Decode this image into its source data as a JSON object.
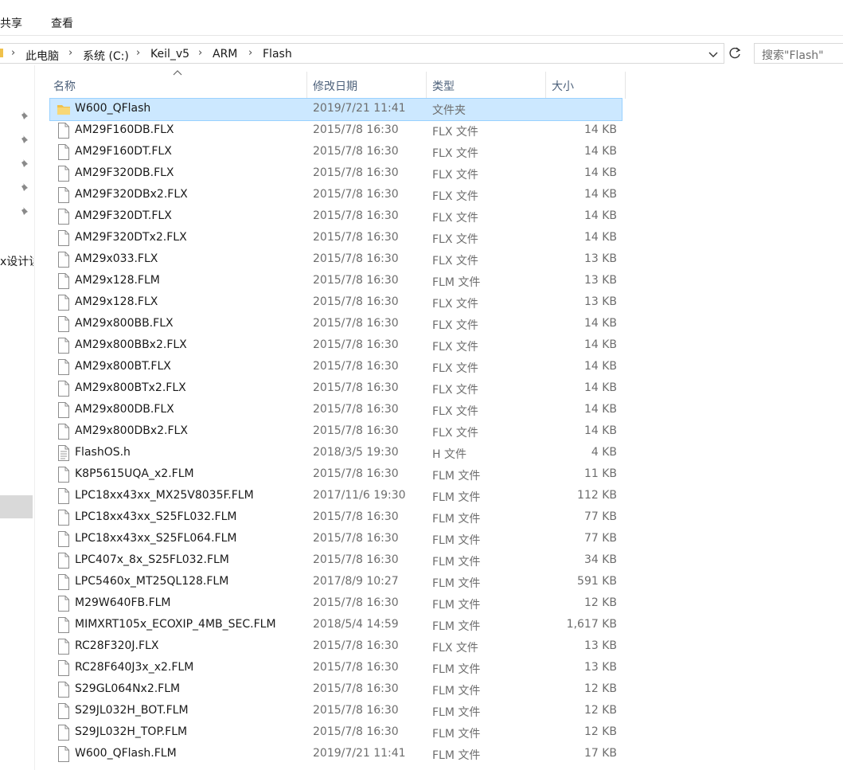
{
  "ribbon": {
    "tabs": [
      "共享",
      "查看"
    ]
  },
  "address": {
    "crumbs": [
      "此电脑",
      "系统 (C:)",
      "Keil_v5",
      "ARM",
      "Flash"
    ],
    "separator": "›"
  },
  "search": {
    "placeholder": "搜索\"Flash\""
  },
  "nav": {
    "partial_label": "x设计读"
  },
  "columns": {
    "name": "名称",
    "date": "修改日期",
    "type": "类型",
    "size": "大小"
  },
  "files": [
    {
      "name": "W600_QFlash",
      "date": "2019/7/21 11:41",
      "type": "文件夹",
      "size": "",
      "icon": "folder-icon",
      "selected": true
    },
    {
      "name": "AM29F160DB.FLX",
      "date": "2015/7/8 16:30",
      "type": "FLX 文件",
      "size": "14 KB",
      "icon": "file-icon"
    },
    {
      "name": "AM29F160DT.FLX",
      "date": "2015/7/8 16:30",
      "type": "FLX 文件",
      "size": "14 KB",
      "icon": "file-icon"
    },
    {
      "name": "AM29F320DB.FLX",
      "date": "2015/7/8 16:30",
      "type": "FLX 文件",
      "size": "14 KB",
      "icon": "file-icon"
    },
    {
      "name": "AM29F320DBx2.FLX",
      "date": "2015/7/8 16:30",
      "type": "FLX 文件",
      "size": "14 KB",
      "icon": "file-icon"
    },
    {
      "name": "AM29F320DT.FLX",
      "date": "2015/7/8 16:30",
      "type": "FLX 文件",
      "size": "14 KB",
      "icon": "file-icon"
    },
    {
      "name": "AM29F320DTx2.FLX",
      "date": "2015/7/8 16:30",
      "type": "FLX 文件",
      "size": "14 KB",
      "icon": "file-icon"
    },
    {
      "name": "AM29x033.FLX",
      "date": "2015/7/8 16:30",
      "type": "FLX 文件",
      "size": "13 KB",
      "icon": "file-icon"
    },
    {
      "name": "AM29x128.FLM",
      "date": "2015/7/8 16:30",
      "type": "FLM 文件",
      "size": "13 KB",
      "icon": "file-icon"
    },
    {
      "name": "AM29x128.FLX",
      "date": "2015/7/8 16:30",
      "type": "FLX 文件",
      "size": "13 KB",
      "icon": "file-icon"
    },
    {
      "name": "AM29x800BB.FLX",
      "date": "2015/7/8 16:30",
      "type": "FLX 文件",
      "size": "14 KB",
      "icon": "file-icon"
    },
    {
      "name": "AM29x800BBx2.FLX",
      "date": "2015/7/8 16:30",
      "type": "FLX 文件",
      "size": "14 KB",
      "icon": "file-icon"
    },
    {
      "name": "AM29x800BT.FLX",
      "date": "2015/7/8 16:30",
      "type": "FLX 文件",
      "size": "14 KB",
      "icon": "file-icon"
    },
    {
      "name": "AM29x800BTx2.FLX",
      "date": "2015/7/8 16:30",
      "type": "FLX 文件",
      "size": "14 KB",
      "icon": "file-icon"
    },
    {
      "name": "AM29x800DB.FLX",
      "date": "2015/7/8 16:30",
      "type": "FLX 文件",
      "size": "14 KB",
      "icon": "file-icon"
    },
    {
      "name": "AM29x800DBx2.FLX",
      "date": "2015/7/8 16:30",
      "type": "FLX 文件",
      "size": "14 KB",
      "icon": "file-icon"
    },
    {
      "name": "FlashOS.h",
      "date": "2018/3/5 19:30",
      "type": "H 文件",
      "size": "4 KB",
      "icon": "text-file-icon"
    },
    {
      "name": "K8P5615UQA_x2.FLM",
      "date": "2015/7/8 16:30",
      "type": "FLM 文件",
      "size": "11 KB",
      "icon": "file-icon"
    },
    {
      "name": "LPC18xx43xx_MX25V8035F.FLM",
      "date": "2017/11/6 19:30",
      "type": "FLM 文件",
      "size": "112 KB",
      "icon": "file-icon"
    },
    {
      "name": "LPC18xx43xx_S25FL032.FLM",
      "date": "2015/7/8 16:30",
      "type": "FLM 文件",
      "size": "77 KB",
      "icon": "file-icon"
    },
    {
      "name": "LPC18xx43xx_S25FL064.FLM",
      "date": "2015/7/8 16:30",
      "type": "FLM 文件",
      "size": "77 KB",
      "icon": "file-icon"
    },
    {
      "name": "LPC407x_8x_S25FL032.FLM",
      "date": "2015/7/8 16:30",
      "type": "FLM 文件",
      "size": "34 KB",
      "icon": "file-icon"
    },
    {
      "name": "LPC5460x_MT25QL128.FLM",
      "date": "2017/8/9 10:27",
      "type": "FLM 文件",
      "size": "591 KB",
      "icon": "file-icon"
    },
    {
      "name": "M29W640FB.FLM",
      "date": "2015/7/8 16:30",
      "type": "FLM 文件",
      "size": "12 KB",
      "icon": "file-icon"
    },
    {
      "name": "MIMXRT105x_ECOXIP_4MB_SEC.FLM",
      "date": "2018/5/4 14:59",
      "type": "FLM 文件",
      "size": "1,617 KB",
      "icon": "file-icon"
    },
    {
      "name": "RC28F320J.FLX",
      "date": "2015/7/8 16:30",
      "type": "FLX 文件",
      "size": "13 KB",
      "icon": "file-icon"
    },
    {
      "name": "RC28F640J3x_x2.FLM",
      "date": "2015/7/8 16:30",
      "type": "FLM 文件",
      "size": "13 KB",
      "icon": "file-icon"
    },
    {
      "name": "S29GL064Nx2.FLM",
      "date": "2015/7/8 16:30",
      "type": "FLM 文件",
      "size": "12 KB",
      "icon": "file-icon"
    },
    {
      "name": "S29JL032H_BOT.FLM",
      "date": "2015/7/8 16:30",
      "type": "FLM 文件",
      "size": "12 KB",
      "icon": "file-icon"
    },
    {
      "name": "S29JL032H_TOP.FLM",
      "date": "2015/7/8 16:30",
      "type": "FLM 文件",
      "size": "12 KB",
      "icon": "file-icon"
    },
    {
      "name": "W600_QFlash.FLM",
      "date": "2019/7/21 11:41",
      "type": "FLM 文件",
      "size": "17 KB",
      "icon": "file-icon"
    }
  ],
  "colors": {
    "selection_bg": "#cce8ff",
    "selection_border": "#99d1ff",
    "header_text": "#4c607a",
    "meta_text": "#6d6d6d",
    "folder": "#f0c14b"
  }
}
